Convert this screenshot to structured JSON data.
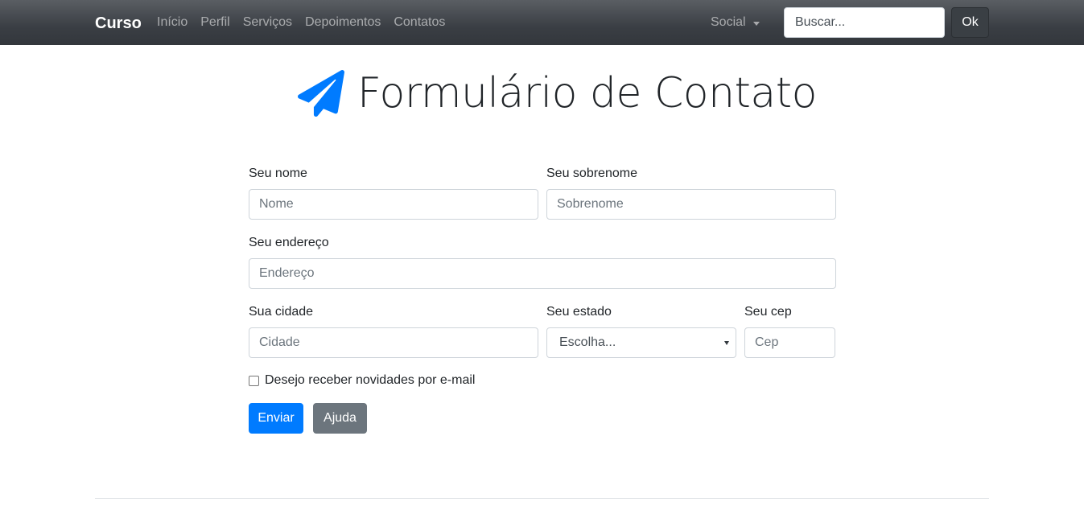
{
  "navbar": {
    "brand": "Curso",
    "links": [
      "Início",
      "Perfil",
      "Serviços",
      "Depoimentos",
      "Contatos"
    ],
    "social_dropdown": "Social",
    "search_placeholder": "Buscar...",
    "search_button": "Ok"
  },
  "header": {
    "icon": "paper-plane-icon",
    "title": "Formulário de Contato"
  },
  "form": {
    "nome_label": "Seu nome",
    "nome_placeholder": "Nome",
    "sobrenome_label": "Seu sobrenome",
    "sobrenome_placeholder": "Sobrenome",
    "endereco_label": "Seu endereço",
    "endereco_placeholder": "Endereço",
    "cidade_label": "Sua cidade",
    "cidade_placeholder": "Cidade",
    "estado_label": "Seu estado",
    "estado_selected": "Escolha...",
    "cep_label": "Seu cep",
    "cep_placeholder": "Cep",
    "newsletter_label": "Desejo receber novidades por e-mail",
    "submit_button": "Enviar",
    "help_button": "Ajuda"
  },
  "colors": {
    "primary": "#007bff",
    "secondary": "#6c757d",
    "navbar": "#3a3e44"
  }
}
